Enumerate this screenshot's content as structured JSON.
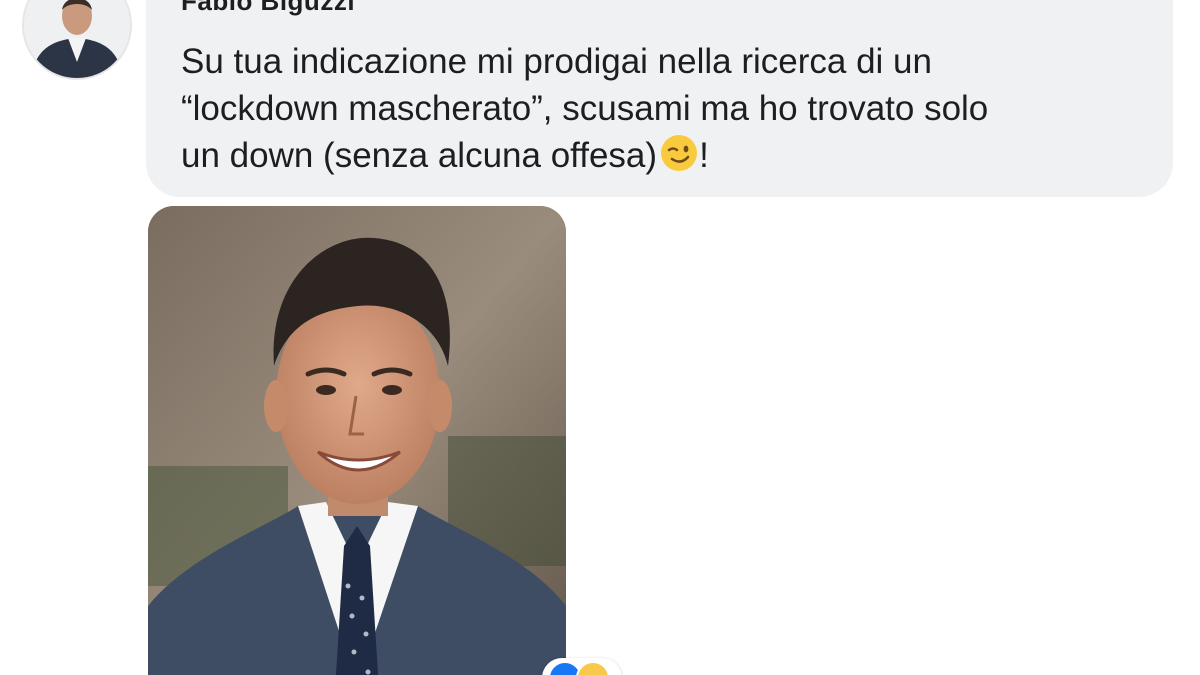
{
  "comment": {
    "author": "Fabio Biguzzi",
    "lines": [
      "Su tua indicazione mi prodigai nella ricerca di un",
      "“lockdown mascherato”, scusami ma ho trovato solo",
      "un down (senza alcuna offesa)"
    ],
    "trailing_emoji": "winking-face-icon",
    "trailing_text": "!"
  },
  "attachment": {
    "type": "photo",
    "subject": "portrait of a smiling man in a dark suit and tie"
  },
  "reactions": {
    "icons": [
      "like-icon",
      "haha-icon"
    ],
    "count": ""
  },
  "colors": {
    "bubble": "#f0f1f3",
    "text": "#1c1e21",
    "like": "#1877f2",
    "haha": "#f7c84a"
  }
}
